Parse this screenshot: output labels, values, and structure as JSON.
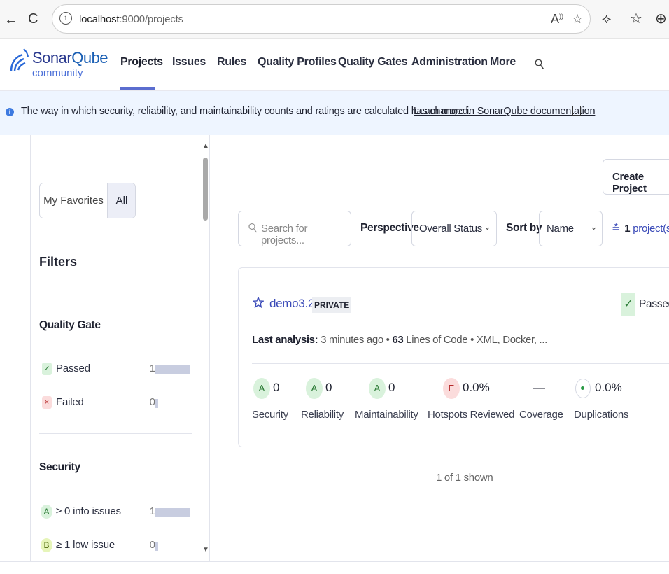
{
  "browser": {
    "url_host": "localhost",
    "url_path": ":9000/projects"
  },
  "nav": {
    "logo_name_part1": "Sonar",
    "logo_name_part2": "Qube",
    "logo_sub": "community",
    "items": [
      "Projects",
      "Issues",
      "Rules",
      "Quality Profiles",
      "Quality Gates",
      "Administration",
      "More"
    ]
  },
  "banner": {
    "text": "The way in which security, reliability, and maintainability counts and ratings are calculated has changed.",
    "link": "Learn more in SonarQube documentation"
  },
  "sidebar": {
    "toggle_favorites": "My Favorites",
    "toggle_all": "All",
    "filters_title": "Filters",
    "quality_gate": {
      "title": "Quality Gate",
      "rows": [
        {
          "badge": "✓",
          "label": "Passed",
          "count": "1",
          "fraction": 1
        },
        {
          "badge": "×",
          "label": "Failed",
          "count": "0",
          "fraction": 0
        }
      ]
    },
    "security": {
      "title": "Security",
      "rows": [
        {
          "badge": "A",
          "label": "≥ 0 info issues",
          "count": "1",
          "fraction": 1
        },
        {
          "badge": "B",
          "label": "≥ 1 low issue",
          "count": "0",
          "fraction": 0
        }
      ]
    }
  },
  "toolbar": {
    "create_project": "Create Project",
    "search_placeholder": "Search for projects...",
    "perspective_label": "Perspective",
    "perspective_value": "Overall Status",
    "sort_label": "Sort by",
    "sort_value": "Name",
    "project_count_number": "1",
    "project_count_suffix": "project(s)"
  },
  "project": {
    "name": "demo3.2",
    "visibility": "PRIVATE",
    "quality_gate": "Passed",
    "last_analysis_label": "Last analysis:",
    "last_analysis_value": "3 minutes ago",
    "loc_number": "63",
    "loc_label": "Lines of Code",
    "languages": "XML, Docker, ...",
    "metrics": [
      {
        "rating": "A",
        "value": "0",
        "label": "Security"
      },
      {
        "rating": "A",
        "value": "0",
        "label": "Reliability"
      },
      {
        "rating": "A",
        "value": "0",
        "label": "Maintainability"
      },
      {
        "rating": "E",
        "value": "0.0%",
        "label": "Hotspots Reviewed"
      },
      {
        "rating": "",
        "value": "—",
        "label": "Coverage"
      },
      {
        "rating": "",
        "value": "0.0%",
        "label": "Duplications"
      }
    ]
  },
  "footer": {
    "shown": "1 of 1 shown"
  },
  "colors": {
    "accent": "#5b6dcf",
    "link": "#3a4ab8",
    "passed_bg": "#d9f2dc",
    "failed_bg": "#fbdcdc"
  }
}
